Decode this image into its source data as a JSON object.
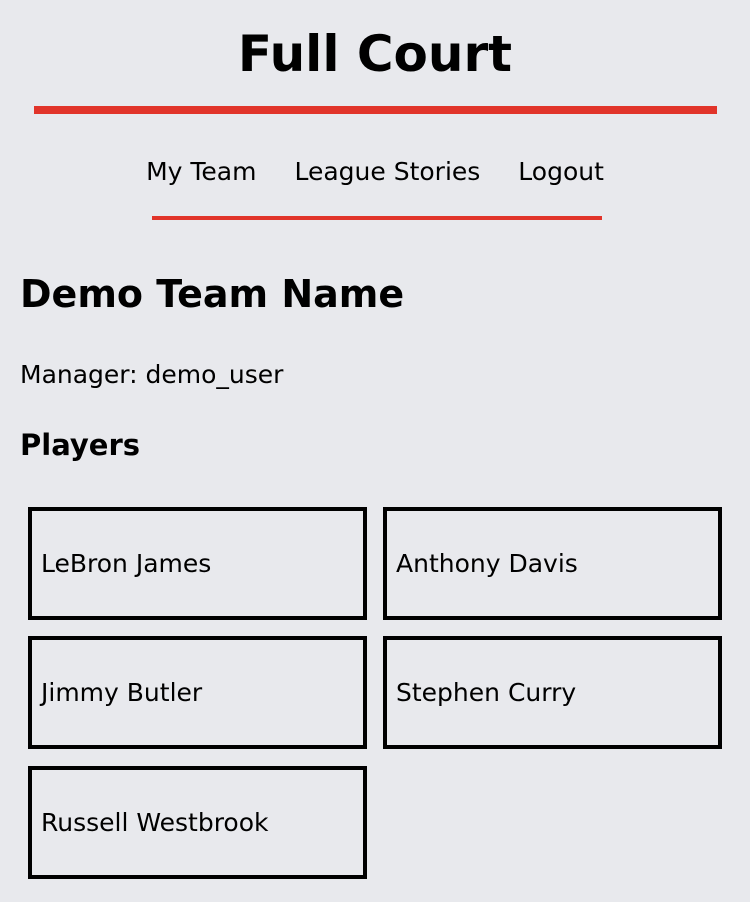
{
  "header": {
    "title": "Full Court"
  },
  "nav": {
    "items": [
      {
        "label": "My Team"
      },
      {
        "label": "League Stories"
      },
      {
        "label": "Logout"
      }
    ]
  },
  "team": {
    "name": "Demo Team Name",
    "manager": "Manager: demo_user",
    "players_heading": "Players",
    "players": [
      {
        "name": "LeBron James"
      },
      {
        "name": "Anthony Davis"
      },
      {
        "name": "Jimmy Butler"
      },
      {
        "name": "Stephen Curry"
      },
      {
        "name": "Russell Westbrook"
      }
    ]
  },
  "colors": {
    "accent": "#e1342a",
    "background": "#e8e9ed"
  }
}
